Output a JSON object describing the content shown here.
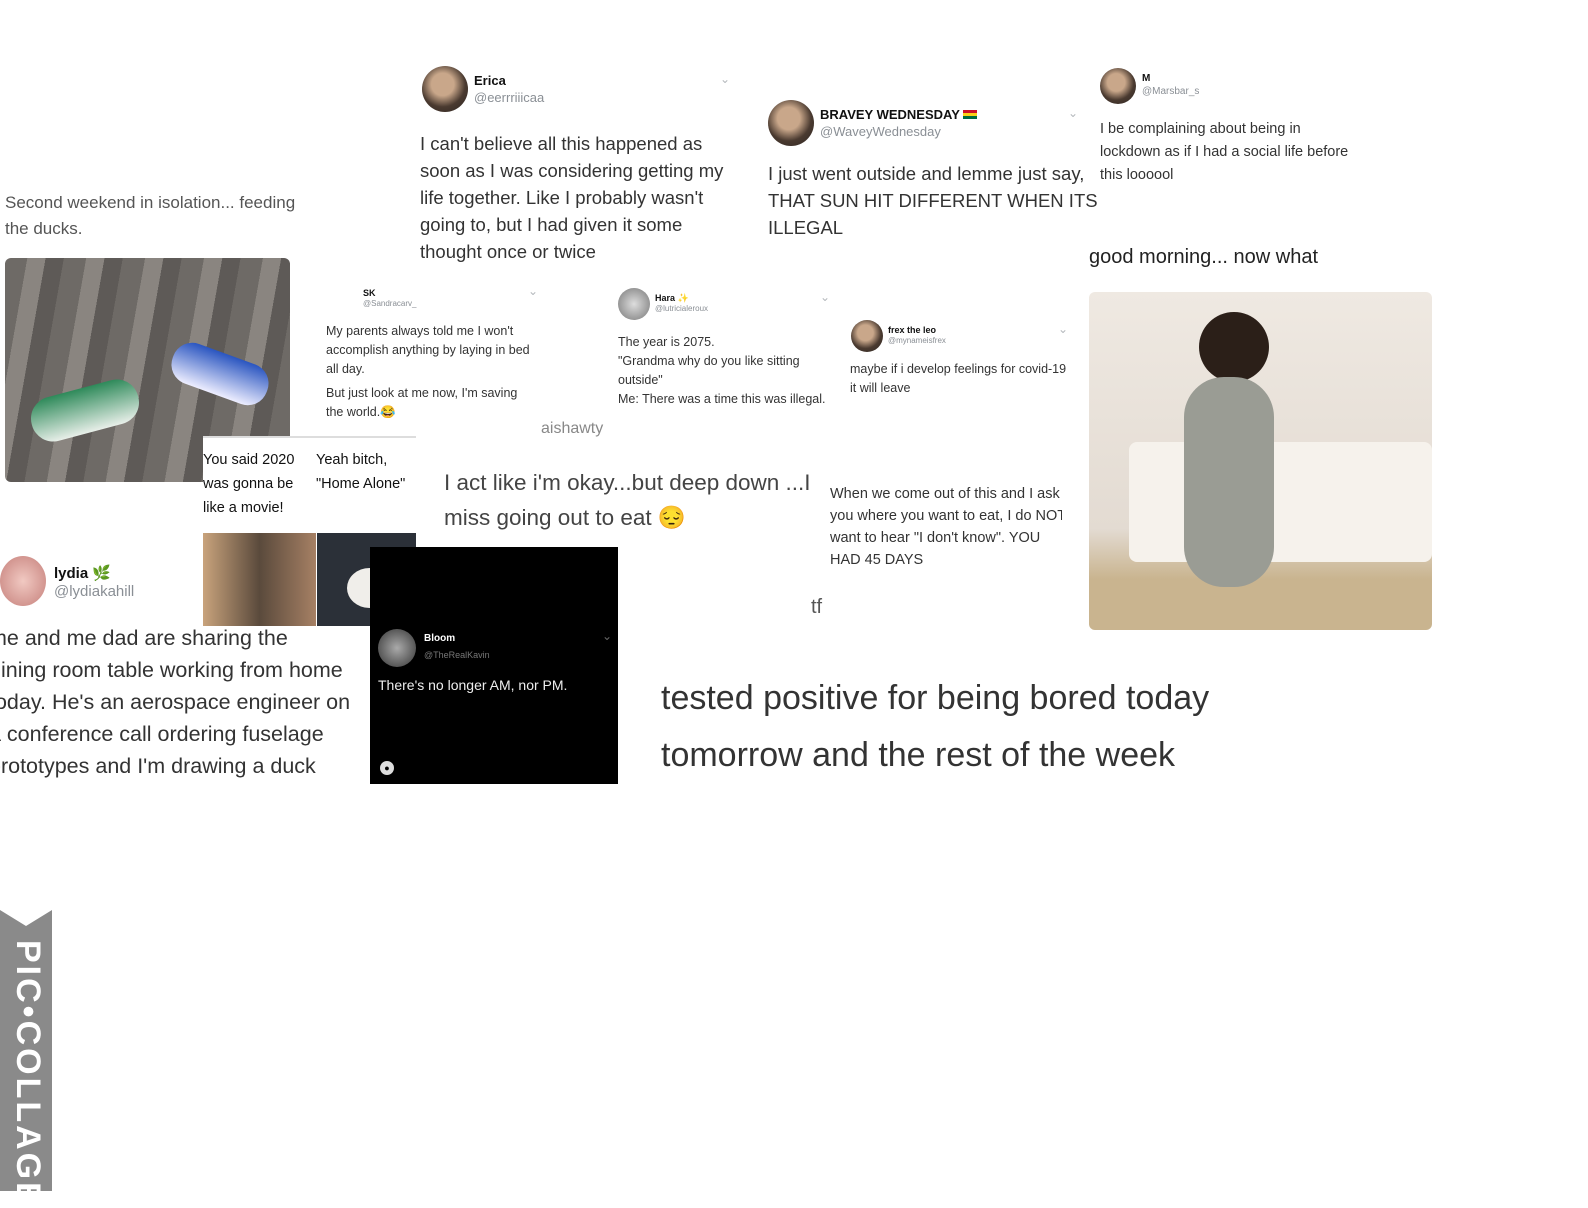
{
  "ducks": {
    "caption_lines": [
      "Second weekend in isolation... feeding",
      "the ducks."
    ]
  },
  "erica": {
    "name": "Erica",
    "handle": "@eerrriiicaa",
    "lines": [
      "I can't believe all this happened as",
      "soon as I was considering getting my",
      "life together. Like I probably wasn't",
      "going to, but I had given it some",
      "thought once or twice"
    ]
  },
  "bravey": {
    "name": "BRAVEY WEDNESDAY",
    "flag": "ghana-flag",
    "handle": "@WaveyWednesday",
    "lines": [
      "I just went outside and lemme just say,",
      "THAT SUN HIT DIFFERENT WHEN ITS",
      "ILLEGAL"
    ]
  },
  "m": {
    "name": "M",
    "handle": "@Marsbar_s",
    "lines": [
      "I be complaining about being in",
      "lockdown as if I had a social life before",
      "this loooool"
    ]
  },
  "morning": {
    "caption": "good morning... now what"
  },
  "sk": {
    "name": "SK",
    "handle": "@Sandracarv_",
    "lines": [
      "My parents always told me I won't",
      "accomplish anything by laying in bed",
      "all day."
    ],
    "lines2": [
      "But just look at me now, I'm saving",
      "the world.😂"
    ]
  },
  "hara": {
    "name": "Hara ✨",
    "handle": "@lutricialeroux",
    "lines": [
      "The year is 2075.",
      "\"Grandma why do you like sitting",
      "outside\"",
      "Me: There was a time this was illegal."
    ]
  },
  "aishawty": {
    "text": "aishawty"
  },
  "frex": {
    "name": "frex the leo",
    "handle": "@mynameisfrex",
    "lines": [
      "maybe if i develop feelings for covid-19",
      "it will leave"
    ]
  },
  "okay": {
    "lines": [
      "I act like i'm okay...but deep down ...I",
      "miss going out to eat 😔"
    ]
  },
  "eat": {
    "lines": [
      "When we come out of this and I ask",
      "you where you want to eat, I do NOT",
      "want to hear \"I don't know\". YOU",
      "HAD 45 DAYS"
    ]
  },
  "tf": {
    "text": "tf"
  },
  "cat_meme": {
    "left_lines": [
      "You said 2020",
      "was gonna be",
      "like a movie!"
    ],
    "right_lines": [
      "Yeah bitch,",
      "\"Home Alone\""
    ]
  },
  "lydia": {
    "name": "lydia 🌿",
    "handle": "@lydiakahill",
    "lines": [
      "me and me dad are sharing the",
      "dining room table working from home",
      "today. He's an aerospace engineer on",
      "a conference call ordering fuselage",
      "prototypes and I'm drawing a duck"
    ]
  },
  "bloom": {
    "name": "Bloom",
    "handle": "@TheRealKavin",
    "text": "There's no longer AM, nor PM."
  },
  "bored": {
    "lines": [
      "tested positive for being bored today",
      "tomorrow and the rest of the week"
    ]
  },
  "watermark": {
    "text": "PIC•COLLAGE"
  }
}
